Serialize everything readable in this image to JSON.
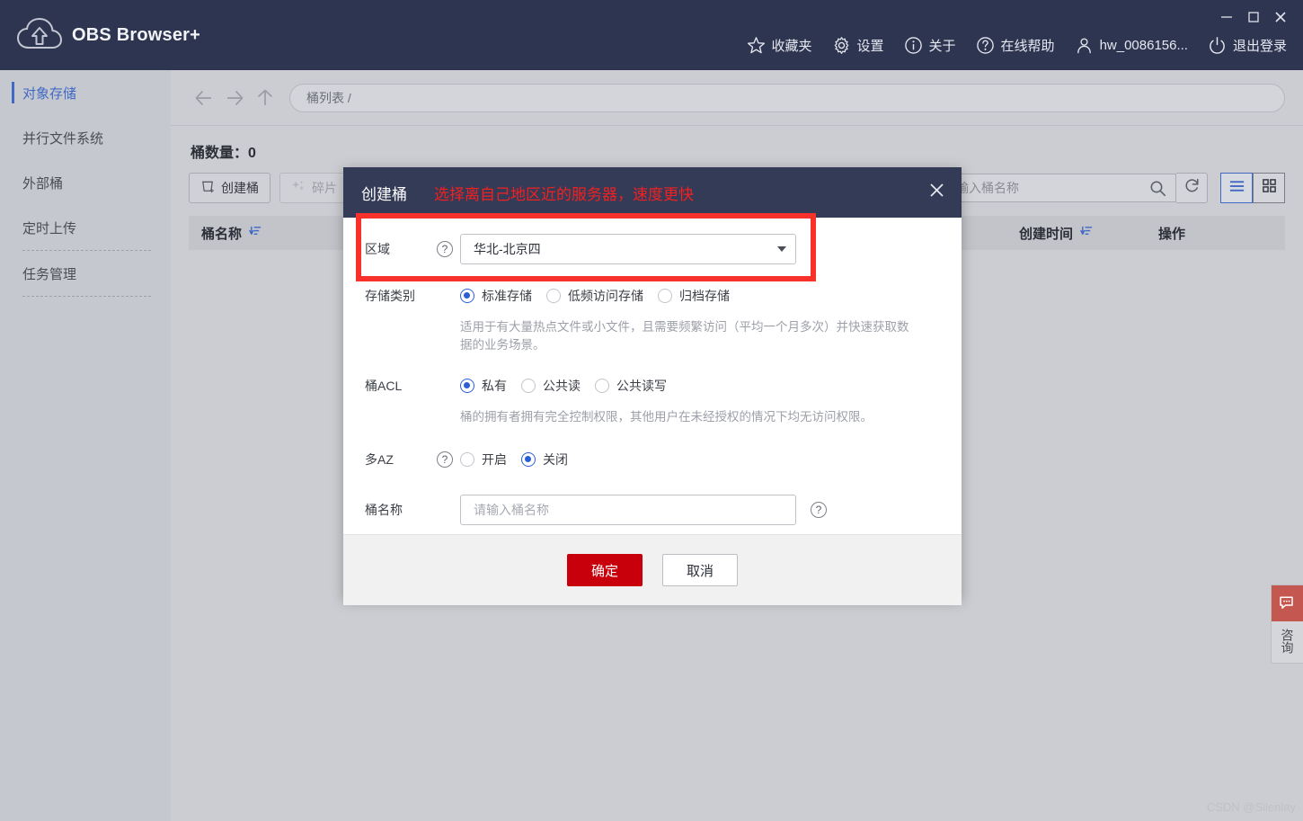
{
  "window": {
    "app_title": "OBS Browser+",
    "controls": {
      "minimize": "—",
      "maximize": "□",
      "close": "✕"
    }
  },
  "header": {
    "menu": [
      {
        "icon": "star-icon",
        "label": "收藏夹"
      },
      {
        "icon": "gear-icon",
        "label": "设置"
      },
      {
        "icon": "info-icon",
        "label": "关于"
      },
      {
        "icon": "question-icon",
        "label": "在线帮助"
      },
      {
        "icon": "user-icon",
        "label": "hw_0086156..."
      },
      {
        "icon": "power-icon",
        "label": "退出登录"
      }
    ]
  },
  "sidebar": {
    "items": [
      {
        "label": "对象存储",
        "active": true
      },
      {
        "label": "并行文件系统",
        "active": false
      },
      {
        "label": "外部桶",
        "active": false
      },
      {
        "label": "定时上传",
        "active": false
      },
      {
        "label": "任务管理",
        "active": false
      }
    ]
  },
  "nav": {
    "back_icon": "arrow-left-icon",
    "forward_icon": "arrow-right-icon",
    "up_icon": "arrow-up-icon",
    "breadcrumb": "桶列表 /"
  },
  "content": {
    "bucket_count_label": "桶数量：0",
    "toolbar": {
      "create_bucket": "创建桶",
      "fragment": "碎片",
      "search_placeholder": "请输入桶名称",
      "search_icon": "search-icon",
      "refresh_icon": "refresh-icon",
      "list_view_icon": "list-view-icon",
      "grid_view_icon": "grid-view-icon"
    },
    "table": {
      "columns": [
        {
          "label": "桶名称",
          "sort_icon": "sort-icon"
        },
        {
          "label": "创建时间",
          "sort_icon": "sort-icon"
        },
        {
          "label": "操作",
          "sort_icon": ""
        }
      ]
    }
  },
  "modal": {
    "title": "创建桶",
    "annotation": "选择离自己地区近的服务器，速度更快",
    "close_icon": "close-icon",
    "fields": {
      "region": {
        "label": "区域",
        "help_icon": "question-icon",
        "value": "华北-北京四",
        "caret_icon": "chevron-down-icon"
      },
      "storage_class": {
        "label": "存储类别",
        "options": [
          {
            "label": "标准存储",
            "selected": true
          },
          {
            "label": "低频访问存储",
            "selected": false
          },
          {
            "label": "归档存储",
            "selected": false
          }
        ],
        "hint": "适用于有大量热点文件或小文件，且需要频繁访问（平均一个月多次）并快速获取数据的业务场景。"
      },
      "bucket_acl": {
        "label": "桶ACL",
        "options": [
          {
            "label": "私有",
            "selected": true
          },
          {
            "label": "公共读",
            "selected": false
          },
          {
            "label": "公共读写",
            "selected": false
          }
        ],
        "hint": "桶的拥有者拥有完全控制权限，其他用户在未经授权的情况下均无访问权限。"
      },
      "multi_az": {
        "label": "多AZ",
        "help_icon": "question-icon",
        "options": [
          {
            "label": "开启",
            "selected": false
          },
          {
            "label": "关闭",
            "selected": true
          }
        ]
      },
      "bucket_name": {
        "label": "桶名称",
        "placeholder": "请输入桶名称",
        "value": "",
        "help_icon": "question-icon"
      }
    },
    "footer": {
      "confirm": "确定",
      "cancel": "取消"
    }
  },
  "consult_widget": {
    "icon": "chat-icon",
    "label": "咨询"
  },
  "watermark": "CSDN @Silenlay",
  "colors": {
    "header_bg": "#2e3550",
    "modal_header_bg": "#343b57",
    "accent_blue": "#4169c4",
    "radio_blue": "#2b5ed4",
    "annotation_red": "#f22020",
    "highlight_red": "#f8312a",
    "primary_button_red": "#c7000b"
  }
}
